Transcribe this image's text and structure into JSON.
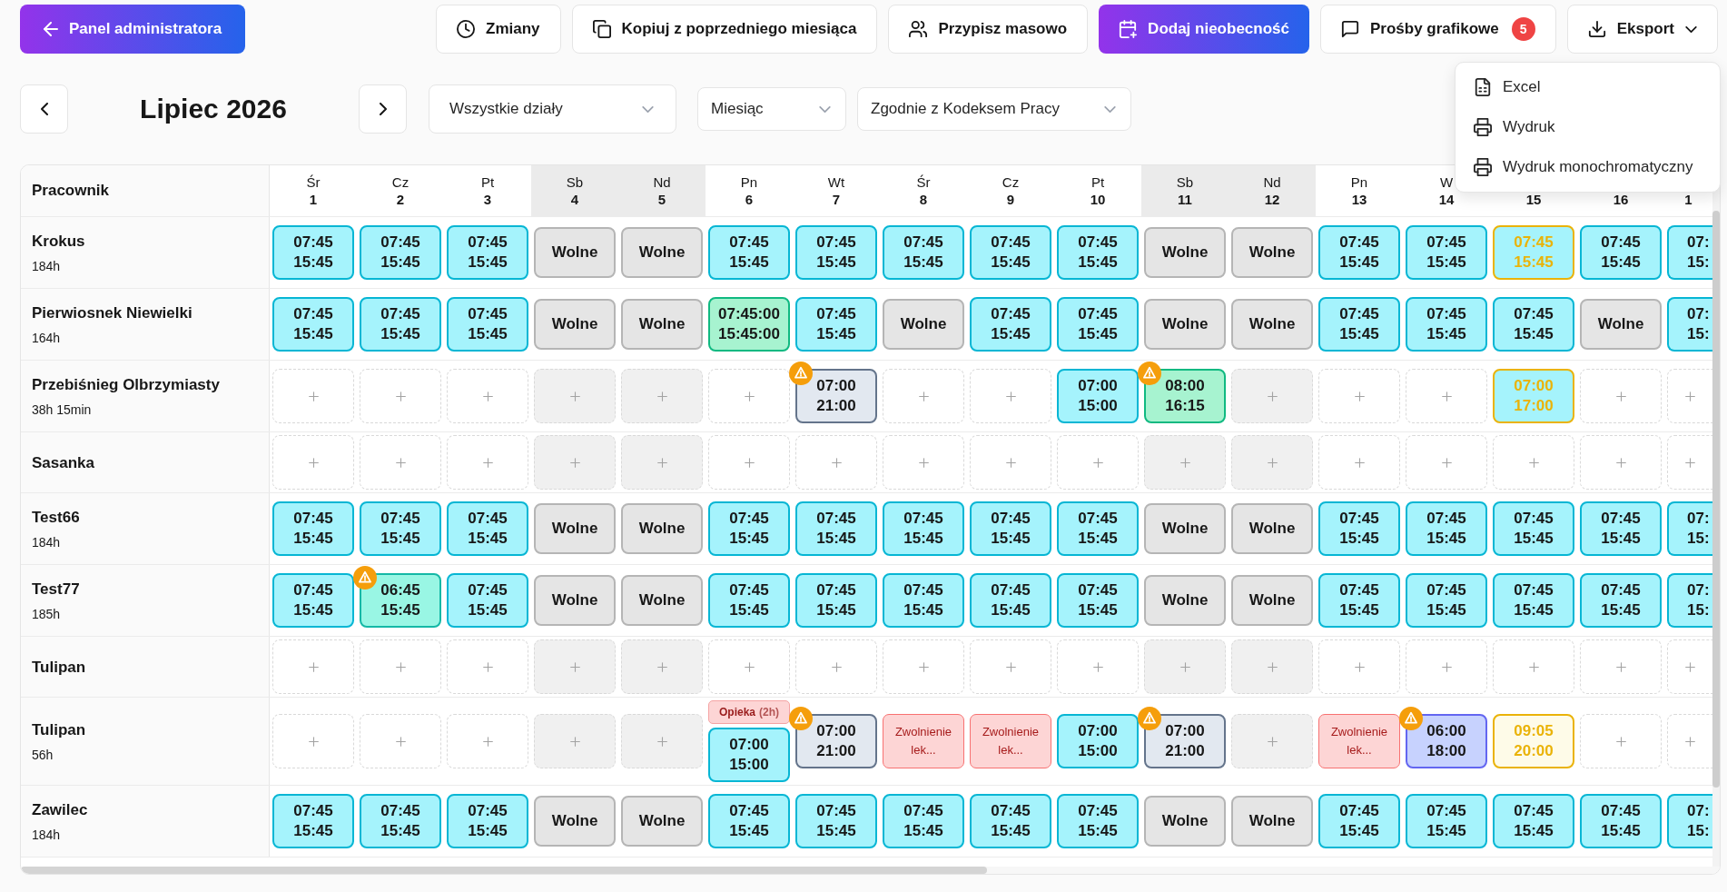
{
  "toolbar": {
    "back_button": "Panel administratora",
    "changes_button": "Zmiany",
    "copy_button": "Kopiuj z poprzedniego miesiąca",
    "bulk_assign_button": "Przypisz masowo",
    "add_absence_button": "Dodaj nieobecność",
    "requests_button": {
      "label": "Prośby grafikowe",
      "badge": "5"
    },
    "export_button": {
      "label": "Eksport",
      "expanded": true
    }
  },
  "export_menu": [
    {
      "kind": "spreadsheet",
      "label": "Excel"
    },
    {
      "kind": "print",
      "label": "Wydruk"
    },
    {
      "kind": "print",
      "label": "Wydruk monochromatyczny"
    }
  ],
  "period": {
    "title": "Lipiec 2026"
  },
  "filters": {
    "department": "Wszystkie działy",
    "range": "Miesiąc",
    "rules": "Zgodnie z Kodeksem Pracy"
  },
  "schedule": {
    "header": "Pracownik",
    "days": [
      {
        "name": "Śr",
        "number": "1",
        "weekend": false
      },
      {
        "name": "Cz",
        "number": "2",
        "weekend": false
      },
      {
        "name": "Pt",
        "number": "3",
        "weekend": false
      },
      {
        "name": "Sb",
        "number": "4",
        "weekend": true
      },
      {
        "name": "Nd",
        "number": "5",
        "weekend": true
      },
      {
        "name": "Pn",
        "number": "6",
        "weekend": false
      },
      {
        "name": "Wt",
        "number": "7",
        "weekend": false
      },
      {
        "name": "Śr",
        "number": "8",
        "weekend": false
      },
      {
        "name": "Cz",
        "number": "9",
        "weekend": false
      },
      {
        "name": "Pt",
        "number": "10",
        "weekend": false
      },
      {
        "name": "Sb",
        "number": "11",
        "weekend": true
      },
      {
        "name": "Nd",
        "number": "12",
        "weekend": true
      },
      {
        "name": "Pn",
        "number": "13",
        "weekend": false
      },
      {
        "name": "W",
        "number": "14",
        "weekend": false
      },
      {
        "number": "15",
        "weekend": false
      },
      {
        "number": "16",
        "weekend": false
      },
      {
        "number": "1",
        "weekend": false
      }
    ],
    "rows": [
      {
        "name": "Krokus",
        "hours": "184h",
        "cells": [
          {
            "kind": "standard",
            "start": "07:45",
            "end": "15:45",
            "pending": false,
            "warning": false
          },
          {
            "kind": "standard",
            "start": "07:45",
            "end": "15:45",
            "pending": false,
            "warning": false
          },
          {
            "kind": "standard",
            "start": "07:45",
            "end": "15:45",
            "pending": false,
            "warning": false
          },
          {
            "kind": "off",
            "label": "Wolne"
          },
          {
            "kind": "off",
            "label": "Wolne"
          },
          {
            "kind": "standard",
            "start": "07:45",
            "end": "15:45",
            "pending": false,
            "warning": false
          },
          {
            "kind": "standard",
            "start": "07:45",
            "end": "15:45",
            "pending": false,
            "warning": false
          },
          {
            "kind": "standard",
            "start": "07:45",
            "end": "15:45",
            "pending": false,
            "warning": false
          },
          {
            "kind": "standard",
            "start": "07:45",
            "end": "15:45",
            "pending": false,
            "warning": false
          },
          {
            "kind": "standard",
            "start": "07:45",
            "end": "15:45",
            "pending": false,
            "warning": false
          },
          {
            "kind": "off",
            "label": "Wolne"
          },
          {
            "kind": "off",
            "label": "Wolne"
          },
          {
            "kind": "standard",
            "start": "07:45",
            "end": "15:45",
            "pending": false,
            "warning": false
          },
          {
            "kind": "standard",
            "start": "07:45",
            "end": "15:45",
            "pending": false,
            "warning": false
          },
          {
            "kind": "standard",
            "start": "07:45",
            "end": "15:45",
            "pending": true,
            "warning": false
          },
          {
            "kind": "standard",
            "start": "07:45",
            "end": "15:45",
            "pending": false,
            "warning": false
          },
          {
            "kind": "standard",
            "start": "07:",
            "end": "15:",
            "pending": false,
            "warning": false
          }
        ]
      },
      {
        "name": "Pierwiosnek Niewielki",
        "hours": "164h",
        "cells": [
          {
            "kind": "standard",
            "start": "07:45",
            "end": "15:45",
            "pending": false,
            "warning": false
          },
          {
            "kind": "standard",
            "start": "07:45",
            "end": "15:45",
            "pending": false,
            "warning": false
          },
          {
            "kind": "standard",
            "start": "07:45",
            "end": "15:45",
            "pending": false,
            "warning": false
          },
          {
            "kind": "off",
            "label": "Wolne"
          },
          {
            "kind": "off",
            "label": "Wolne"
          },
          {
            "kind": "custom",
            "start": "07:45:00",
            "end": "15:45:00",
            "pending": false,
            "warning": false
          },
          {
            "kind": "standard",
            "start": "07:45",
            "end": "15:45",
            "pending": false,
            "warning": false
          },
          {
            "kind": "off",
            "label": "Wolne"
          },
          {
            "kind": "standard",
            "start": "07:45",
            "end": "15:45",
            "pending": false,
            "warning": false
          },
          {
            "kind": "standard",
            "start": "07:45",
            "end": "15:45",
            "pending": false,
            "warning": false
          },
          {
            "kind": "off",
            "label": "Wolne"
          },
          {
            "kind": "off",
            "label": "Wolne"
          },
          {
            "kind": "standard",
            "start": "07:45",
            "end": "15:45",
            "pending": false,
            "warning": false
          },
          {
            "kind": "standard",
            "start": "07:45",
            "end": "15:45",
            "pending": false,
            "warning": false
          },
          {
            "kind": "standard",
            "start": "07:45",
            "end": "15:45",
            "pending": false,
            "warning": false
          },
          {
            "kind": "off",
            "label": "Wolne"
          },
          {
            "kind": "standard",
            "start": "07:",
            "end": "15:",
            "pending": false,
            "warning": false
          }
        ]
      },
      {
        "name": "Przebiśnieg Olbrzymiasty",
        "hours": "38h 15min",
        "cells": [
          {
            "kind": "empty"
          },
          {
            "kind": "empty"
          },
          {
            "kind": "empty"
          },
          {
            "kind": "empty"
          },
          {
            "kind": "empty"
          },
          {
            "kind": "empty"
          },
          {
            "kind": "long",
            "start": "07:00",
            "end": "21:00",
            "pending": false,
            "warning": true
          },
          {
            "kind": "empty"
          },
          {
            "kind": "empty"
          },
          {
            "kind": "standard",
            "start": "07:00",
            "end": "15:00",
            "pending": false,
            "warning": false
          },
          {
            "kind": "custom",
            "start": "08:00",
            "end": "16:15",
            "pending": false,
            "warning": true
          },
          {
            "kind": "empty"
          },
          {
            "kind": "empty"
          },
          {
            "kind": "empty"
          },
          {
            "kind": "standard",
            "start": "07:00",
            "end": "17:00",
            "pending": true,
            "warning": false
          },
          {
            "kind": "empty"
          },
          {
            "kind": "empty"
          }
        ]
      },
      {
        "name": "Sasanka",
        "cells": [
          {
            "kind": "empty"
          },
          {
            "kind": "empty"
          },
          {
            "kind": "empty"
          },
          {
            "kind": "empty"
          },
          {
            "kind": "empty"
          },
          {
            "kind": "empty"
          },
          {
            "kind": "empty"
          },
          {
            "kind": "empty"
          },
          {
            "kind": "empty"
          },
          {
            "kind": "empty"
          },
          {
            "kind": "empty"
          },
          {
            "kind": "empty"
          },
          {
            "kind": "empty"
          },
          {
            "kind": "empty"
          },
          {
            "kind": "empty"
          },
          {
            "kind": "empty"
          },
          {
            "kind": "empty"
          }
        ]
      },
      {
        "name": "Test66",
        "hours": "184h",
        "cells": [
          {
            "kind": "standard",
            "start": "07:45",
            "end": "15:45",
            "pending": false,
            "warning": false
          },
          {
            "kind": "standard",
            "start": "07:45",
            "end": "15:45",
            "pending": false,
            "warning": false
          },
          {
            "kind": "standard",
            "start": "07:45",
            "end": "15:45",
            "pending": false,
            "warning": false
          },
          {
            "kind": "off",
            "label": "Wolne"
          },
          {
            "kind": "off",
            "label": "Wolne"
          },
          {
            "kind": "standard",
            "start": "07:45",
            "end": "15:45",
            "pending": false,
            "warning": false
          },
          {
            "kind": "standard",
            "start": "07:45",
            "end": "15:45",
            "pending": false,
            "warning": false
          },
          {
            "kind": "standard",
            "start": "07:45",
            "end": "15:45",
            "pending": false,
            "warning": false
          },
          {
            "kind": "standard",
            "start": "07:45",
            "end": "15:45",
            "pending": false,
            "warning": false
          },
          {
            "kind": "standard",
            "start": "07:45",
            "end": "15:45",
            "pending": false,
            "warning": false
          },
          {
            "kind": "off",
            "label": "Wolne"
          },
          {
            "kind": "off",
            "label": "Wolne"
          },
          {
            "kind": "standard",
            "start": "07:45",
            "end": "15:45",
            "pending": false,
            "warning": false
          },
          {
            "kind": "standard",
            "start": "07:45",
            "end": "15:45",
            "pending": false,
            "warning": false
          },
          {
            "kind": "standard",
            "start": "07:45",
            "end": "15:45",
            "pending": false,
            "warning": false
          },
          {
            "kind": "standard",
            "start": "07:45",
            "end": "15:45",
            "pending": false,
            "warning": false
          },
          {
            "kind": "standard",
            "start": "07:",
            "end": "15:",
            "pending": false,
            "warning": false
          }
        ]
      },
      {
        "name": "Test77",
        "hours": "185h",
        "cells": [
          {
            "kind": "standard",
            "start": "07:45",
            "end": "15:45",
            "pending": false,
            "warning": false
          },
          {
            "kind": "adjusted",
            "start": "06:45",
            "end": "15:45",
            "pending": false,
            "warning": true
          },
          {
            "kind": "standard",
            "start": "07:45",
            "end": "15:45",
            "pending": false,
            "warning": false
          },
          {
            "kind": "off",
            "label": "Wolne"
          },
          {
            "kind": "off",
            "label": "Wolne"
          },
          {
            "kind": "standard",
            "start": "07:45",
            "end": "15:45",
            "pending": false,
            "warning": false
          },
          {
            "kind": "standard",
            "start": "07:45",
            "end": "15:45",
            "pending": false,
            "warning": false
          },
          {
            "kind": "standard",
            "start": "07:45",
            "end": "15:45",
            "pending": false,
            "warning": false
          },
          {
            "kind": "standard",
            "start": "07:45",
            "end": "15:45",
            "pending": false,
            "warning": false
          },
          {
            "kind": "standard",
            "start": "07:45",
            "end": "15:45",
            "pending": false,
            "warning": false
          },
          {
            "kind": "off",
            "label": "Wolne"
          },
          {
            "kind": "off",
            "label": "Wolne"
          },
          {
            "kind": "standard",
            "start": "07:45",
            "end": "15:45",
            "pending": false,
            "warning": false
          },
          {
            "kind": "standard",
            "start": "07:45",
            "end": "15:45",
            "pending": false,
            "warning": false
          },
          {
            "kind": "standard",
            "start": "07:45",
            "end": "15:45",
            "pending": false,
            "warning": false
          },
          {
            "kind": "standard",
            "start": "07:45",
            "end": "15:45",
            "pending": false,
            "warning": false
          },
          {
            "kind": "standard",
            "start": "07:",
            "end": "15:",
            "pending": false,
            "warning": false
          }
        ]
      },
      {
        "name": "Tulipan",
        "cells": [
          {
            "kind": "empty"
          },
          {
            "kind": "empty"
          },
          {
            "kind": "empty"
          },
          {
            "kind": "empty"
          },
          {
            "kind": "empty"
          },
          {
            "kind": "empty"
          },
          {
            "kind": "empty"
          },
          {
            "kind": "empty"
          },
          {
            "kind": "empty"
          },
          {
            "kind": "empty"
          },
          {
            "kind": "empty"
          },
          {
            "kind": "empty"
          },
          {
            "kind": "empty"
          },
          {
            "kind": "empty"
          },
          {
            "kind": "empty"
          },
          {
            "kind": "empty"
          },
          {
            "kind": "empty"
          }
        ]
      },
      {
        "name": "Tulipan",
        "hours": "56h",
        "cells": [
          {
            "kind": "empty"
          },
          {
            "kind": "empty"
          },
          {
            "kind": "empty"
          },
          {
            "kind": "empty"
          },
          {
            "kind": "empty"
          },
          {
            "kind": "standard",
            "start": "07:00",
            "end": "15:00",
            "pending": false,
            "warning": false,
            "tag": {
              "label": "Opieka",
              "note": "(2h)"
            }
          },
          {
            "kind": "long",
            "start": "07:00",
            "end": "21:00",
            "pending": false,
            "warning": true
          },
          {
            "kind": "leave",
            "label": "Zwolnienie lek..."
          },
          {
            "kind": "leave",
            "label": "Zwolnienie lek..."
          },
          {
            "kind": "standard",
            "start": "07:00",
            "end": "15:00",
            "pending": false,
            "warning": false
          },
          {
            "kind": "long",
            "start": "07:00",
            "end": "21:00",
            "pending": false,
            "warning": true
          },
          {
            "kind": "empty"
          },
          {
            "kind": "leave",
            "label": "Zwolnienie lek..."
          },
          {
            "kind": "night",
            "start": "06:00",
            "end": "18:00",
            "pending": false,
            "warning": true
          },
          {
            "kind": "request",
            "start": "09:05",
            "end": "20:00",
            "pending": true,
            "warning": false
          },
          {
            "kind": "empty"
          },
          {
            "kind": "empty"
          }
        ]
      },
      {
        "name": "Zawilec",
        "hours": "184h",
        "cells": [
          {
            "kind": "standard",
            "start": "07:45",
            "end": "15:45",
            "pending": false,
            "warning": false
          },
          {
            "kind": "standard",
            "start": "07:45",
            "end": "15:45",
            "pending": false,
            "warning": false
          },
          {
            "kind": "standard",
            "start": "07:45",
            "end": "15:45",
            "pending": false,
            "warning": false
          },
          {
            "kind": "off",
            "label": "Wolne"
          },
          {
            "kind": "off",
            "label": "Wolne"
          },
          {
            "kind": "standard",
            "start": "07:45",
            "end": "15:45",
            "pending": false,
            "warning": false
          },
          {
            "kind": "standard",
            "start": "07:45",
            "end": "15:45",
            "pending": false,
            "warning": false
          },
          {
            "kind": "standard",
            "start": "07:45",
            "end": "15:45",
            "pending": false,
            "warning": false
          },
          {
            "kind": "standard",
            "start": "07:45",
            "end": "15:45",
            "pending": false,
            "warning": false
          },
          {
            "kind": "standard",
            "start": "07:45",
            "end": "15:45",
            "pending": false,
            "warning": false
          },
          {
            "kind": "off",
            "label": "Wolne"
          },
          {
            "kind": "off",
            "label": "Wolne"
          },
          {
            "kind": "standard",
            "start": "07:45",
            "end": "15:45",
            "pending": false,
            "warning": false
          },
          {
            "kind": "standard",
            "start": "07:45",
            "end": "15:45",
            "pending": false,
            "warning": false
          },
          {
            "kind": "standard",
            "start": "07:45",
            "end": "15:45",
            "pending": false,
            "warning": false
          },
          {
            "kind": "standard",
            "start": "07:45",
            "end": "15:45",
            "pending": false,
            "warning": false
          },
          {
            "kind": "standard",
            "start": "07:",
            "end": "15:",
            "pending": false,
            "warning": false
          }
        ]
      }
    ]
  }
}
